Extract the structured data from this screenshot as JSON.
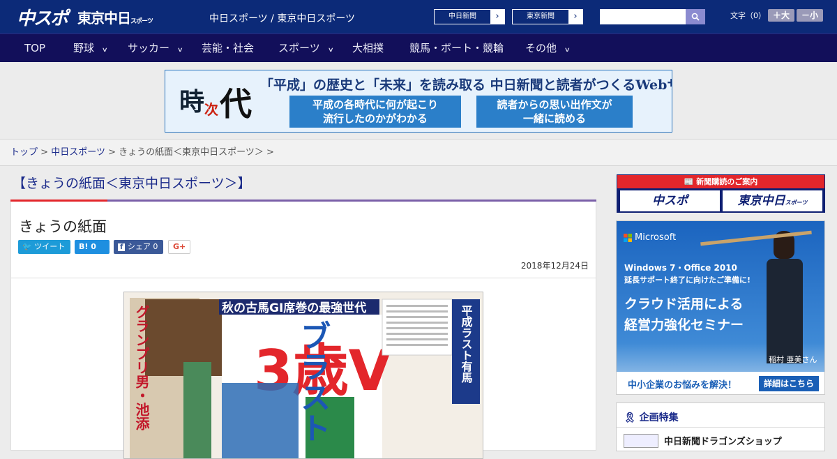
{
  "header": {
    "logo_main": "中スポ",
    "logo_tokyo": "東京中日",
    "logo_tokyo_small": "スポーツ",
    "site_links": "中日スポーツ / 東京中日スポーツ",
    "ext_links": [
      {
        "label": "中日新聞"
      },
      {
        "label": "東京新聞"
      }
    ],
    "search_placeholder": "",
    "font_size_label": "文字（0）",
    "font_bigger": "＋大",
    "font_smaller": "－小"
  },
  "nav": {
    "items": [
      {
        "label": "TOP",
        "has_menu": false
      },
      {
        "label": "野球",
        "has_menu": true
      },
      {
        "label": "サッカー",
        "has_menu": true
      },
      {
        "label": "芸能・社会",
        "has_menu": false
      },
      {
        "label": "スポーツ",
        "has_menu": true
      },
      {
        "label": "大相撲",
        "has_menu": false
      },
      {
        "label": "競馬・ボート・競輪",
        "has_menu": false
      },
      {
        "label": "その他",
        "has_menu": true
      }
    ]
  },
  "banner": {
    "logo_a": "時",
    "logo_b": "次",
    "logo_c": "代",
    "headline": "「平成」の歴史と「未来」を読み取る 中日新聞と読者がつくるWebサイト",
    "box1": [
      "平成の各時代に何が起こり",
      "流行したのかがわかる"
    ],
    "box2": [
      "読者からの思い出作文が",
      "一緒に読める"
    ]
  },
  "breadcrumb": {
    "home": "トップ",
    "sep": ">",
    "section": "中日スポーツ",
    "current": "きょうの紙面＜東京中日スポーツ＞"
  },
  "page": {
    "title": "【きょうの紙面＜東京中日スポーツ＞】",
    "article_title": "きょうの紙面",
    "date": "2018年12月24日"
  },
  "share": {
    "tweet": "ツイート",
    "hatena_mark": "B!",
    "hatena_count": "0",
    "fb_label": "シェア",
    "fb_count": "0",
    "gplus": "G+"
  },
  "newspaper": {
    "kicker": "秋の古馬GⅠ席巻の最強世代",
    "main_headline": "ブラスト",
    "big_number": "3歳V",
    "side_title": "グランプリ男・池添",
    "right_title": "平成ラスト有馬"
  },
  "sidebar": {
    "subscribe_header": "新聞購読のご案内",
    "sub_a": "中スポ",
    "sub_b": "東京中日",
    "sub_b_small": "スポーツ",
    "ad": {
      "brand": "Microsoft",
      "line1": "Windows 7・Office 2010",
      "line2": "延長サポート終了に向けたご準備に!",
      "title1": "クラウド活用による",
      "title2": "経営力強化セミナー",
      "person": "稲村 亜美さん",
      "cta_text": "中小企業のお悩みを解決！",
      "cta_button": "詳細はこちら"
    },
    "feature_title": "企画特集",
    "feature_item": "中日新聞ドラゴンズショップ"
  },
  "colors": {
    "header_bg": "#0c2a78",
    "nav_bg": "#120f5a",
    "accent_red": "#e3262b",
    "link": "#1a2a8a"
  }
}
